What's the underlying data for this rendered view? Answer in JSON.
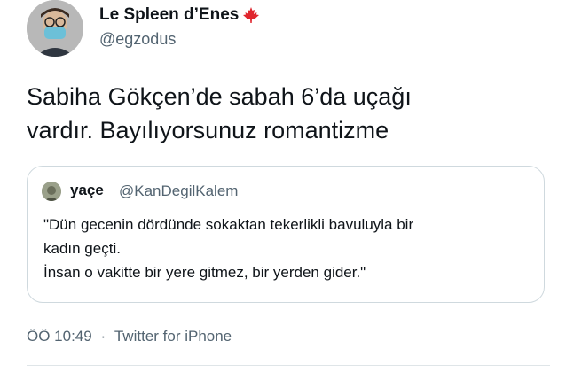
{
  "author": {
    "display_name": "Le Spleen d’Enes",
    "handle": "@egzodus",
    "badge_icon": "maple-leaf-icon"
  },
  "tweet": {
    "lines": [
      "Sabiha Gökçen’de sabah 6’da uçağı",
      "vardır. Bayılıyorsunuz romantizme"
    ]
  },
  "quoted_tweet": {
    "name": "yaçe",
    "handle": "@KanDegilKalem",
    "lines": [
      "\"Dün gecenin dördünde sokaktan tekerlikli bavuluyla bir",
      "kadın geçti.",
      "İnsan o vakitte bir yere gitmez, bir yerden gider.\""
    ]
  },
  "meta": {
    "time": "ÖÖ 10:49",
    "separator": "·",
    "source": "Twitter for iPhone"
  },
  "colors": {
    "text": "#0f1419",
    "secondary": "#536471",
    "border": "#cfd9de",
    "leaf": "#e0262e"
  }
}
